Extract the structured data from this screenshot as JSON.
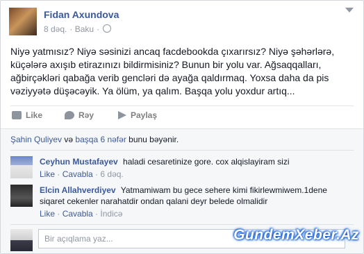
{
  "post": {
    "author": "Fidan Axundova",
    "time": "8 dəq.",
    "location": "Baku",
    "text": "Niyə yatmısız? Niyə səsinizi ancaq facdebookda çıxarırsız? Niyə şəhərlərə, küçələrə axışıb etirazınızı bildirmisiniz? Bunun bir yolu var. Ağsaqqalları, ağbirçəkləri qabağa verib gencləri də ayağa qaldırmaq. Yoxsa daha da pis vəziyyətə düşəcəyik. Ya ölüm, ya qalım. Başqa yolu yoxdur artıq..."
  },
  "actions": {
    "like": "Like",
    "reply": "Rəy",
    "share": "Paylaş"
  },
  "likes": {
    "name1": "Şahin Quliyev",
    "and": "və",
    "others": "başqa 6 nəfər",
    "suffix": "bunu bəyənir."
  },
  "comments": [
    {
      "name": "Ceyhun Mustafayev",
      "text": "haladi cesaretinize gore. cox alqislayiram sizi",
      "like": "Like",
      "reply": "Cavabla",
      "time": "6 dəq."
    },
    {
      "name": "Elcin Allahverdiyev",
      "text": "Yatmamiwam bu gece sehere kimi fikirlewmiwem.1dene siqaret cekenler narahatdir ondan qalani deyr belede olmalidir",
      "like": "Like",
      "reply": "Cavabla",
      "time": "İndicə"
    }
  ],
  "comment_box": {
    "placeholder": "Bir açıqlama yaz..."
  },
  "watermark": "GundemXeber.Az"
}
